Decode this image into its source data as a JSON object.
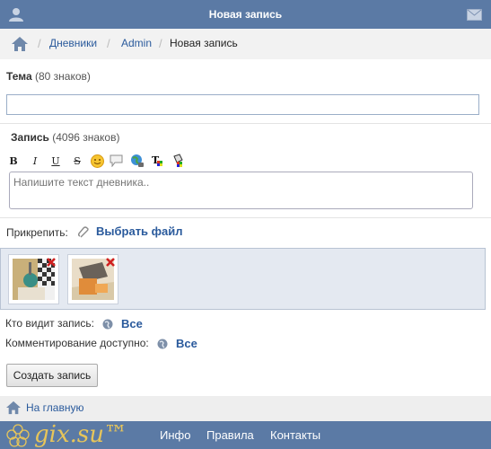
{
  "header": {
    "title": "Новая запись"
  },
  "breadcrumb": {
    "items": [
      "Дневники",
      "Admin"
    ],
    "current": "Новая запись",
    "separator": "/"
  },
  "topic": {
    "label": "Тема",
    "hint": "(80 знаков)",
    "value": ""
  },
  "entry": {
    "label": "Запись",
    "hint": "(4096 знаков)",
    "placeholder": "Напишите текст дневника.."
  },
  "toolbar": {
    "bold": "B",
    "italic": "I",
    "underline": "U",
    "strike": "S"
  },
  "attach": {
    "label": "Прикрепить:",
    "button": "Выбрать файл"
  },
  "privacy": {
    "who_label": "Кто видит запись:",
    "who_value": "Все",
    "comments_label": "Комментирование доступно:",
    "comments_value": "Все"
  },
  "submit": {
    "label": "Создать запись"
  },
  "home": {
    "label": "На главную"
  },
  "footer": {
    "logo": "gix.su™",
    "links": [
      "Инфо",
      "Правила",
      "Контакты"
    ]
  },
  "colors": {
    "header_bg": "#5b7aa5",
    "link": "#2a5a9c",
    "files_bg": "#e4e9f1",
    "logo_gold": "#e7c55a"
  }
}
